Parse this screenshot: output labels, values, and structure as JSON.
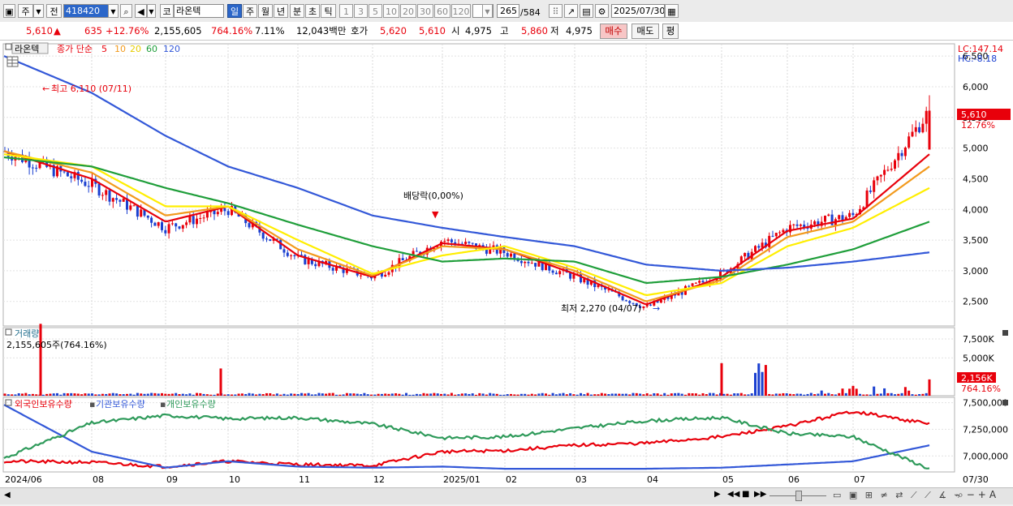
{
  "toolbar": {
    "market_label": "주",
    "prev_label": "전",
    "stock_code": "418420",
    "code_prefix": "코",
    "stock_name": "라온텍",
    "period_buttons": [
      "일",
      "주",
      "월",
      "년",
      "분",
      "초",
      "틱"
    ],
    "period_selected": "일",
    "interval_buttons": [
      "1",
      "3",
      "5",
      "10",
      "20",
      "30",
      "60",
      "120"
    ],
    "count_current": "265",
    "count_total": "/584",
    "date": "2025/07/30"
  },
  "quote": {
    "price": "5,610",
    "arrow": "▲",
    "change": "635",
    "change_pct": "+12.76%",
    "volume": "2,155,605",
    "volume_pct": "764.16%",
    "turnover_pct": "7.11%",
    "trade_value": "12,043백만",
    "hoga_label": "호가",
    "hoga_ask": "5,620",
    "hoga_bid": "5,610",
    "open_label": "시",
    "open": "4,975",
    "high_label": "고",
    "high": "5,860",
    "low_label": "저",
    "low": "4,975",
    "buy_label": "매수",
    "sell_label": "매도",
    "eval_label": "평"
  },
  "colors": {
    "up": "#e8000b",
    "down": "#1a3fd0",
    "ma5": "#e8000b",
    "ma10": "#f29a1d",
    "ma20": "#ffee00",
    "ma60": "#1f9e3a",
    "ma120": "#3358d8",
    "foreign": "#e8000b",
    "institution": "#3358d8",
    "individual": "#2e9a5a"
  },
  "price_panel": {
    "stock_label": "라온텍",
    "ma_label": "종가 단순",
    "ma_periods": [
      "5",
      "10",
      "20",
      "60",
      "120"
    ],
    "lc_label": "LC:147.14",
    "hc_label": "HC:-8.18",
    "high_annotation": "최고 6,110 (07/11)",
    "low_annotation": "최저 2,270 (04/07)",
    "dividend_annotation": "배당락(0,00%)",
    "current_price_tag": "5,610",
    "current_pct_tag": "12.76%",
    "y_ticks": [
      "6,500",
      "6,000",
      "5,500",
      "5,000",
      "4,500",
      "4,000",
      "3,500",
      "3,000",
      "2,500"
    ]
  },
  "volume_panel": {
    "title": "거래량",
    "value_label": "2,155,605주(764.16%)",
    "y_ticks": [
      "7,500K",
      "5,000K"
    ],
    "current_tag": "2,156K",
    "current_pct_tag": "764.16%"
  },
  "holding_panel": {
    "legend": [
      "외국인보유수량",
      "기관보유수량",
      "개인보유수량"
    ],
    "y_ticks": [
      "7,500,000",
      "7,250,000",
      "7,000,000"
    ]
  },
  "x_axis": {
    "labels": [
      "2024/06",
      "08",
      "09",
      "10",
      "11",
      "12",
      "2025/01",
      "02",
      "03",
      "04",
      "05",
      "06",
      "07"
    ],
    "right_label": "07/30"
  },
  "chart_data": [
    {
      "type": "candlestick",
      "title": "",
      "x": [
        "2024/06",
        "08",
        "09",
        "10",
        "11",
        "12",
        "2025/01",
        "02",
        "03",
        "04",
        "05",
        "06",
        "07",
        "07/30"
      ],
      "close": [
        4950,
        4400,
        3700,
        4000,
        3200,
        2900,
        3500,
        3300,
        2900,
        2400,
        2950,
        3700,
        3900,
        5610
      ],
      "ylim": [
        2100,
        6700
      ],
      "series": [
        {
          "name": "5",
          "values": [
            4950,
            4500,
            3800,
            4050,
            3250,
            2900,
            3450,
            3350,
            2950,
            2450,
            2900,
            3650,
            3850,
            4900
          ]
        },
        {
          "name": "10",
          "values": [
            4950,
            4600,
            3900,
            4050,
            3350,
            2920,
            3400,
            3350,
            3000,
            2500,
            2850,
            3550,
            3800,
            4700
          ]
        },
        {
          "name": "20",
          "values": [
            4900,
            4700,
            4050,
            4050,
            3500,
            2950,
            3250,
            3400,
            3050,
            2600,
            2800,
            3400,
            3700,
            4350
          ]
        },
        {
          "name": "60",
          "values": [
            4850,
            4700,
            4350,
            4100,
            3750,
            3400,
            3150,
            3200,
            3150,
            2800,
            2900,
            3100,
            3350,
            3800
          ]
        },
        {
          "name": "120",
          "values": [
            6500,
            5900,
            5200,
            4700,
            4350,
            3900,
            3700,
            3550,
            3400,
            3100,
            3000,
            3050,
            3150,
            3300
          ]
        }
      ],
      "annotations": [
        {
          "text": "최고 6,110 (07/11)",
          "x": "2024/06",
          "y": 6110
        },
        {
          "text": "최저 2,270 (04/07)",
          "x": "04",
          "y": 2270
        },
        {
          "text": "배당락(0,00%)",
          "x": "2025/01",
          "y": 4000
        }
      ]
    },
    {
      "type": "bar",
      "title": "거래량",
      "x": [
        "2024/06",
        "08",
        "09",
        "10",
        "11",
        "12",
        "2025/01",
        "02",
        "03",
        "04",
        "05",
        "06",
        "07",
        "07/30"
      ],
      "values_k": [
        9500,
        250,
        180,
        3600,
        200,
        180,
        350,
        220,
        180,
        260,
        4300,
        600,
        1300,
        2156
      ],
      "ylim": [
        0,
        9000
      ]
    },
    {
      "type": "line",
      "title": "",
      "x": [
        "2024/06",
        "08",
        "09",
        "10",
        "11",
        "12",
        "2025/01",
        "02",
        "03",
        "04",
        "05",
        "06",
        "07",
        "07/30"
      ],
      "ylim": [
        6850000,
        7550000
      ],
      "series": [
        {
          "name": "외국인보유수량",
          "values": [
            6950000,
            6940000,
            6900000,
            6950000,
            6920000,
            6910000,
            7040000,
            7050000,
            7100000,
            7120000,
            7180000,
            7280000,
            7420000,
            7300000
          ]
        },
        {
          "name": "기관보유수량",
          "values": [
            7480000,
            7040000,
            6890000,
            6950000,
            6900000,
            6890000,
            6900000,
            6880000,
            6880000,
            6880000,
            6890000,
            6920000,
            6950000,
            7100000
          ]
        },
        {
          "name": "개인보유수량",
          "values": [
            6980000,
            7310000,
            7380000,
            7350000,
            7360000,
            7300000,
            7170000,
            7180000,
            7260000,
            7330000,
            7360000,
            7210000,
            7180000,
            6880000
          ]
        }
      ]
    }
  ]
}
